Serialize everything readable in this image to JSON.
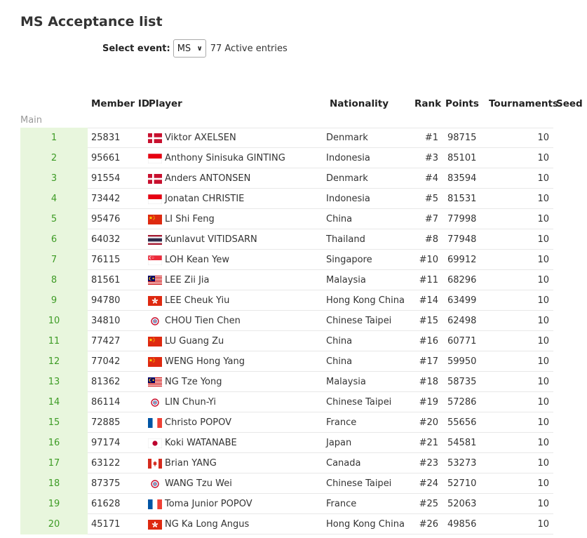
{
  "page": {
    "title": "MS Acceptance list",
    "select_label": "Select event:",
    "select_value": "MS",
    "entries_count": "77 Active entries",
    "section_label": "Main"
  },
  "columns": {
    "member_id": "Member ID",
    "player": "Player",
    "nationality": "Nationality",
    "rank": "Rank",
    "points": "Points",
    "tournaments": "Tournaments",
    "seed": "Seed"
  },
  "rows": [
    {
      "num": "1",
      "member_id": "25831",
      "player": "Viktor AXELSEN",
      "nationality": "Denmark",
      "rank": "#1",
      "points": "98715",
      "tournaments": "10",
      "flag": "denmark-flag"
    },
    {
      "num": "2",
      "member_id": "95661",
      "player": "Anthony Sinisuka GINTING",
      "nationality": "Indonesia",
      "rank": "#3",
      "points": "85101",
      "tournaments": "10",
      "flag": "indonesia-flag"
    },
    {
      "num": "3",
      "member_id": "91554",
      "player": "Anders ANTONSEN",
      "nationality": "Denmark",
      "rank": "#4",
      "points": "83594",
      "tournaments": "10",
      "flag": "denmark-flag"
    },
    {
      "num": "4",
      "member_id": "73442",
      "player": "Jonatan CHRISTIE",
      "nationality": "Indonesia",
      "rank": "#5",
      "points": "81531",
      "tournaments": "10",
      "flag": "indonesia-flag"
    },
    {
      "num": "5",
      "member_id": "95476",
      "player": "LI Shi Feng",
      "nationality": "China",
      "rank": "#7",
      "points": "77998",
      "tournaments": "10",
      "flag": "china-flag"
    },
    {
      "num": "6",
      "member_id": "64032",
      "player": "Kunlavut VITIDSARN",
      "nationality": "Thailand",
      "rank": "#8",
      "points": "77948",
      "tournaments": "10",
      "flag": "thailand-flag"
    },
    {
      "num": "7",
      "member_id": "76115",
      "player": "LOH Kean Yew",
      "nationality": "Singapore",
      "rank": "#10",
      "points": "69912",
      "tournaments": "10",
      "flag": "singapore-flag"
    },
    {
      "num": "8",
      "member_id": "81561",
      "player": "LEE Zii Jia",
      "nationality": "Malaysia",
      "rank": "#11",
      "points": "68296",
      "tournaments": "10",
      "flag": "malaysia-flag"
    },
    {
      "num": "9",
      "member_id": "94780",
      "player": "LEE Cheuk Yiu",
      "nationality": "Hong Kong China",
      "rank": "#14",
      "points": "63499",
      "tournaments": "10",
      "flag": "hong-kong-flag"
    },
    {
      "num": "10",
      "member_id": "34810",
      "player": "CHOU Tien Chen",
      "nationality": "Chinese Taipei",
      "rank": "#15",
      "points": "62498",
      "tournaments": "10",
      "flag": "chinese-taipei-flag"
    },
    {
      "num": "11",
      "member_id": "77427",
      "player": "LU Guang Zu",
      "nationality": "China",
      "rank": "#16",
      "points": "60771",
      "tournaments": "10",
      "flag": "china-flag"
    },
    {
      "num": "12",
      "member_id": "77042",
      "player": "WENG Hong Yang",
      "nationality": "China",
      "rank": "#17",
      "points": "59950",
      "tournaments": "10",
      "flag": "china-flag"
    },
    {
      "num": "13",
      "member_id": "81362",
      "player": "NG Tze Yong",
      "nationality": "Malaysia",
      "rank": "#18",
      "points": "58735",
      "tournaments": "10",
      "flag": "malaysia-flag"
    },
    {
      "num": "14",
      "member_id": "86114",
      "player": "LIN Chun-Yi",
      "nationality": "Chinese Taipei",
      "rank": "#19",
      "points": "57286",
      "tournaments": "10",
      "flag": "chinese-taipei-flag"
    },
    {
      "num": "15",
      "member_id": "72885",
      "player": "Christo POPOV",
      "nationality": "France",
      "rank": "#20",
      "points": "55656",
      "tournaments": "10",
      "flag": "france-flag"
    },
    {
      "num": "16",
      "member_id": "97174",
      "player": "Koki WATANABE",
      "nationality": "Japan",
      "rank": "#21",
      "points": "54581",
      "tournaments": "10",
      "flag": "japan-flag"
    },
    {
      "num": "17",
      "member_id": "63122",
      "player": "Brian YANG",
      "nationality": "Canada",
      "rank": "#23",
      "points": "53273",
      "tournaments": "10",
      "flag": "canada-flag"
    },
    {
      "num": "18",
      "member_id": "87375",
      "player": "WANG Tzu Wei",
      "nationality": "Chinese Taipei",
      "rank": "#24",
      "points": "52710",
      "tournaments": "10",
      "flag": "chinese-taipei-flag"
    },
    {
      "num": "19",
      "member_id": "61628",
      "player": "Toma Junior POPOV",
      "nationality": "France",
      "rank": "#25",
      "points": "52063",
      "tournaments": "10",
      "flag": "france-flag"
    },
    {
      "num": "20",
      "member_id": "45171",
      "player": "NG Ka Long Angus",
      "nationality": "Hong Kong China",
      "rank": "#26",
      "points": "49856",
      "tournaments": "10",
      "flag": "hong-kong-flag"
    }
  ]
}
